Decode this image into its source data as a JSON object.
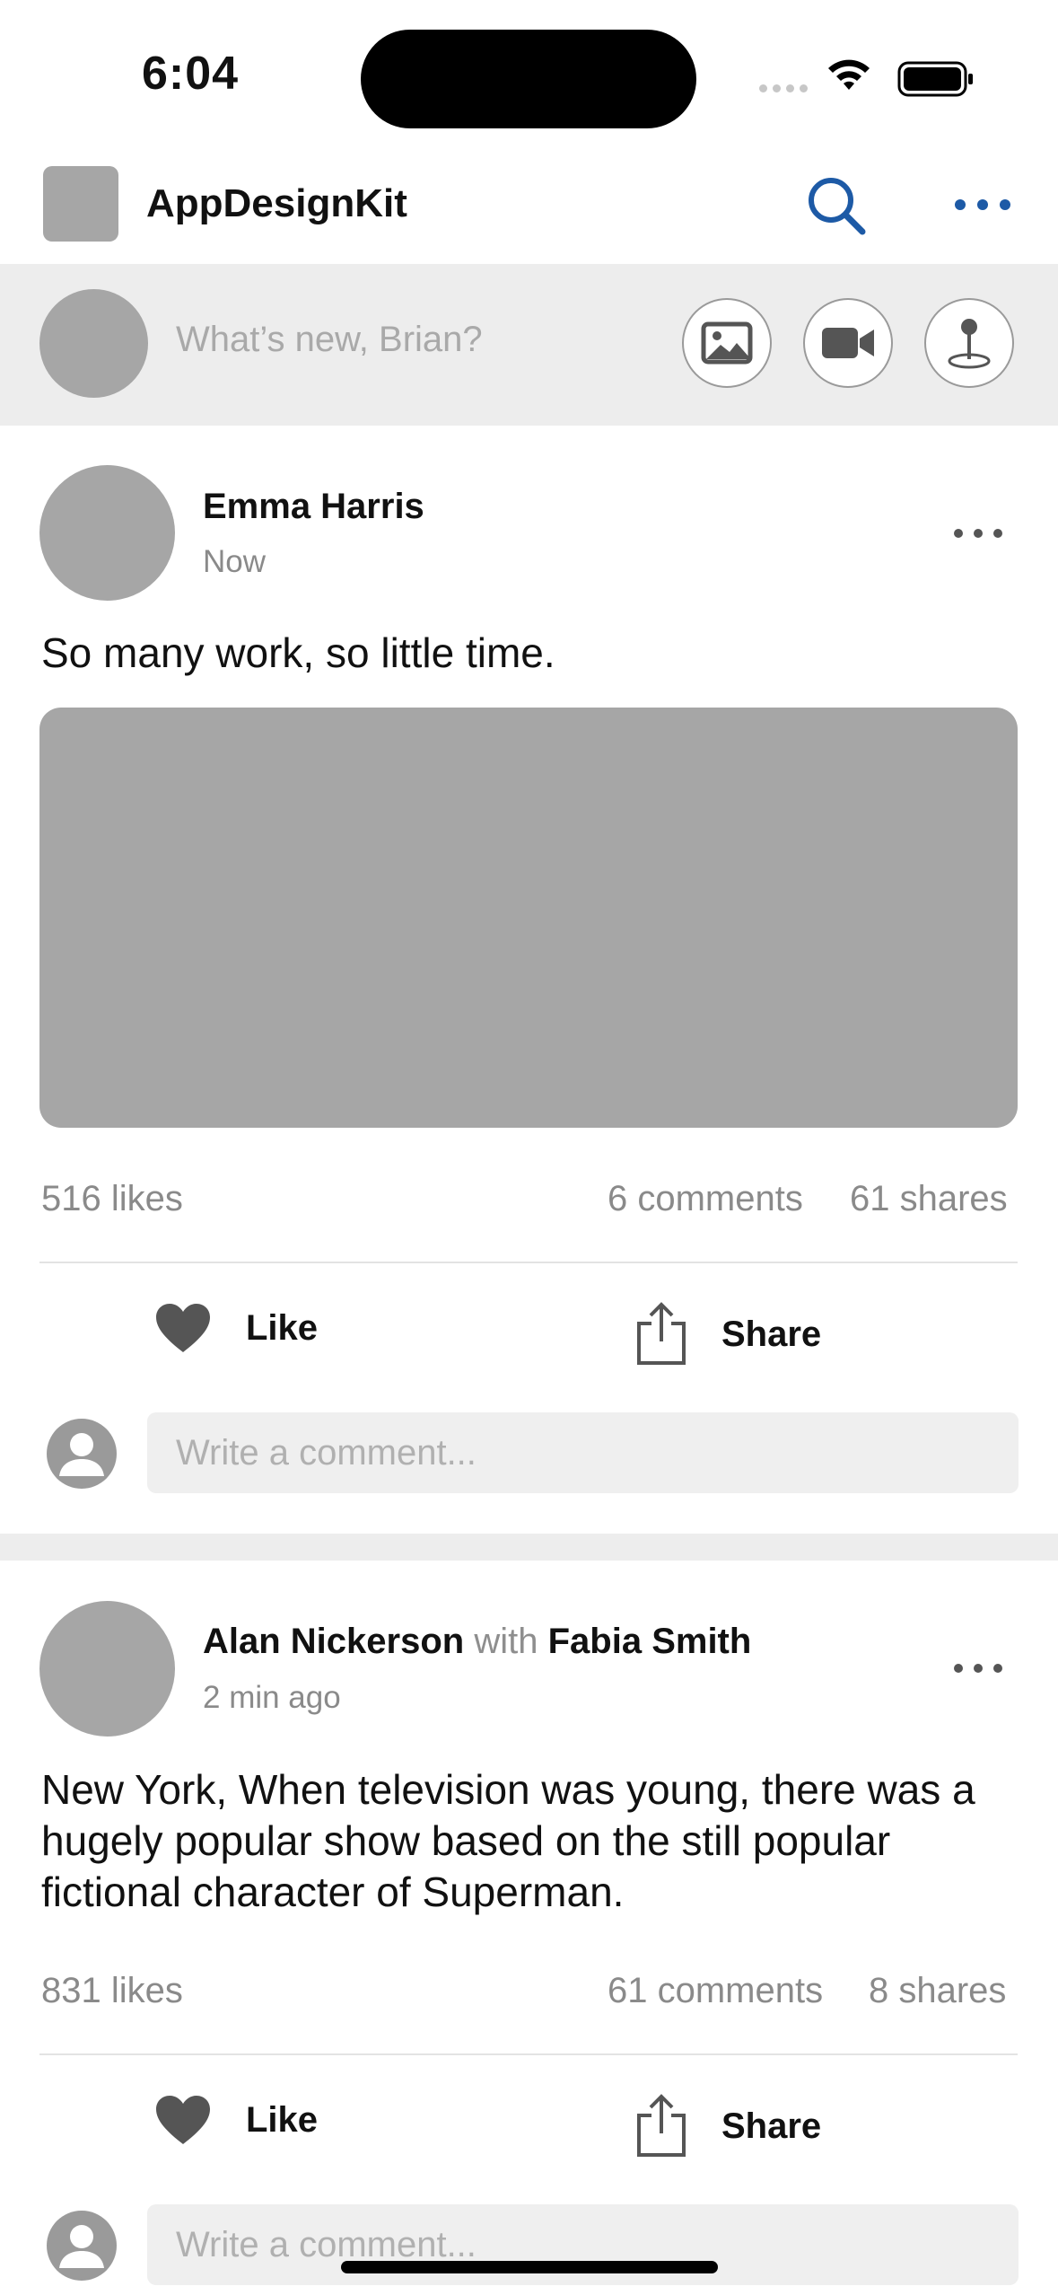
{
  "status_bar": {
    "time": "6:04"
  },
  "header": {
    "title": "AppDesignKit",
    "accent": "#1d5aa6"
  },
  "composer": {
    "placeholder": "What’s new, Brian?"
  },
  "posts": [
    {
      "author": "Emma Harris",
      "time": "Now",
      "text": "So many work, so little time.",
      "likes": "516 likes",
      "comments": "6 comments",
      "shares": "61 shares",
      "like_label": "Like",
      "share_label": "Share",
      "comment_placeholder": "Write a comment..."
    },
    {
      "author": "Alan Nickerson",
      "with_word": "with",
      "tagged": "Fabia Smith",
      "time": "2 min ago",
      "text": "New York, When television was young, there was a hugely popular show based on the still popular fictional character of Superman.",
      "likes": "831 likes",
      "comments": "61 comments",
      "shares": "8 shares",
      "like_label": "Like",
      "share_label": "Share",
      "comment_placeholder": "Write a comment..."
    }
  ],
  "icons": {
    "search": "search-icon",
    "more": "more-icon",
    "photo": "photo-icon",
    "video": "video-icon",
    "location": "location-icon",
    "like": "heart-icon",
    "share": "share-icon",
    "user": "user-icon"
  }
}
